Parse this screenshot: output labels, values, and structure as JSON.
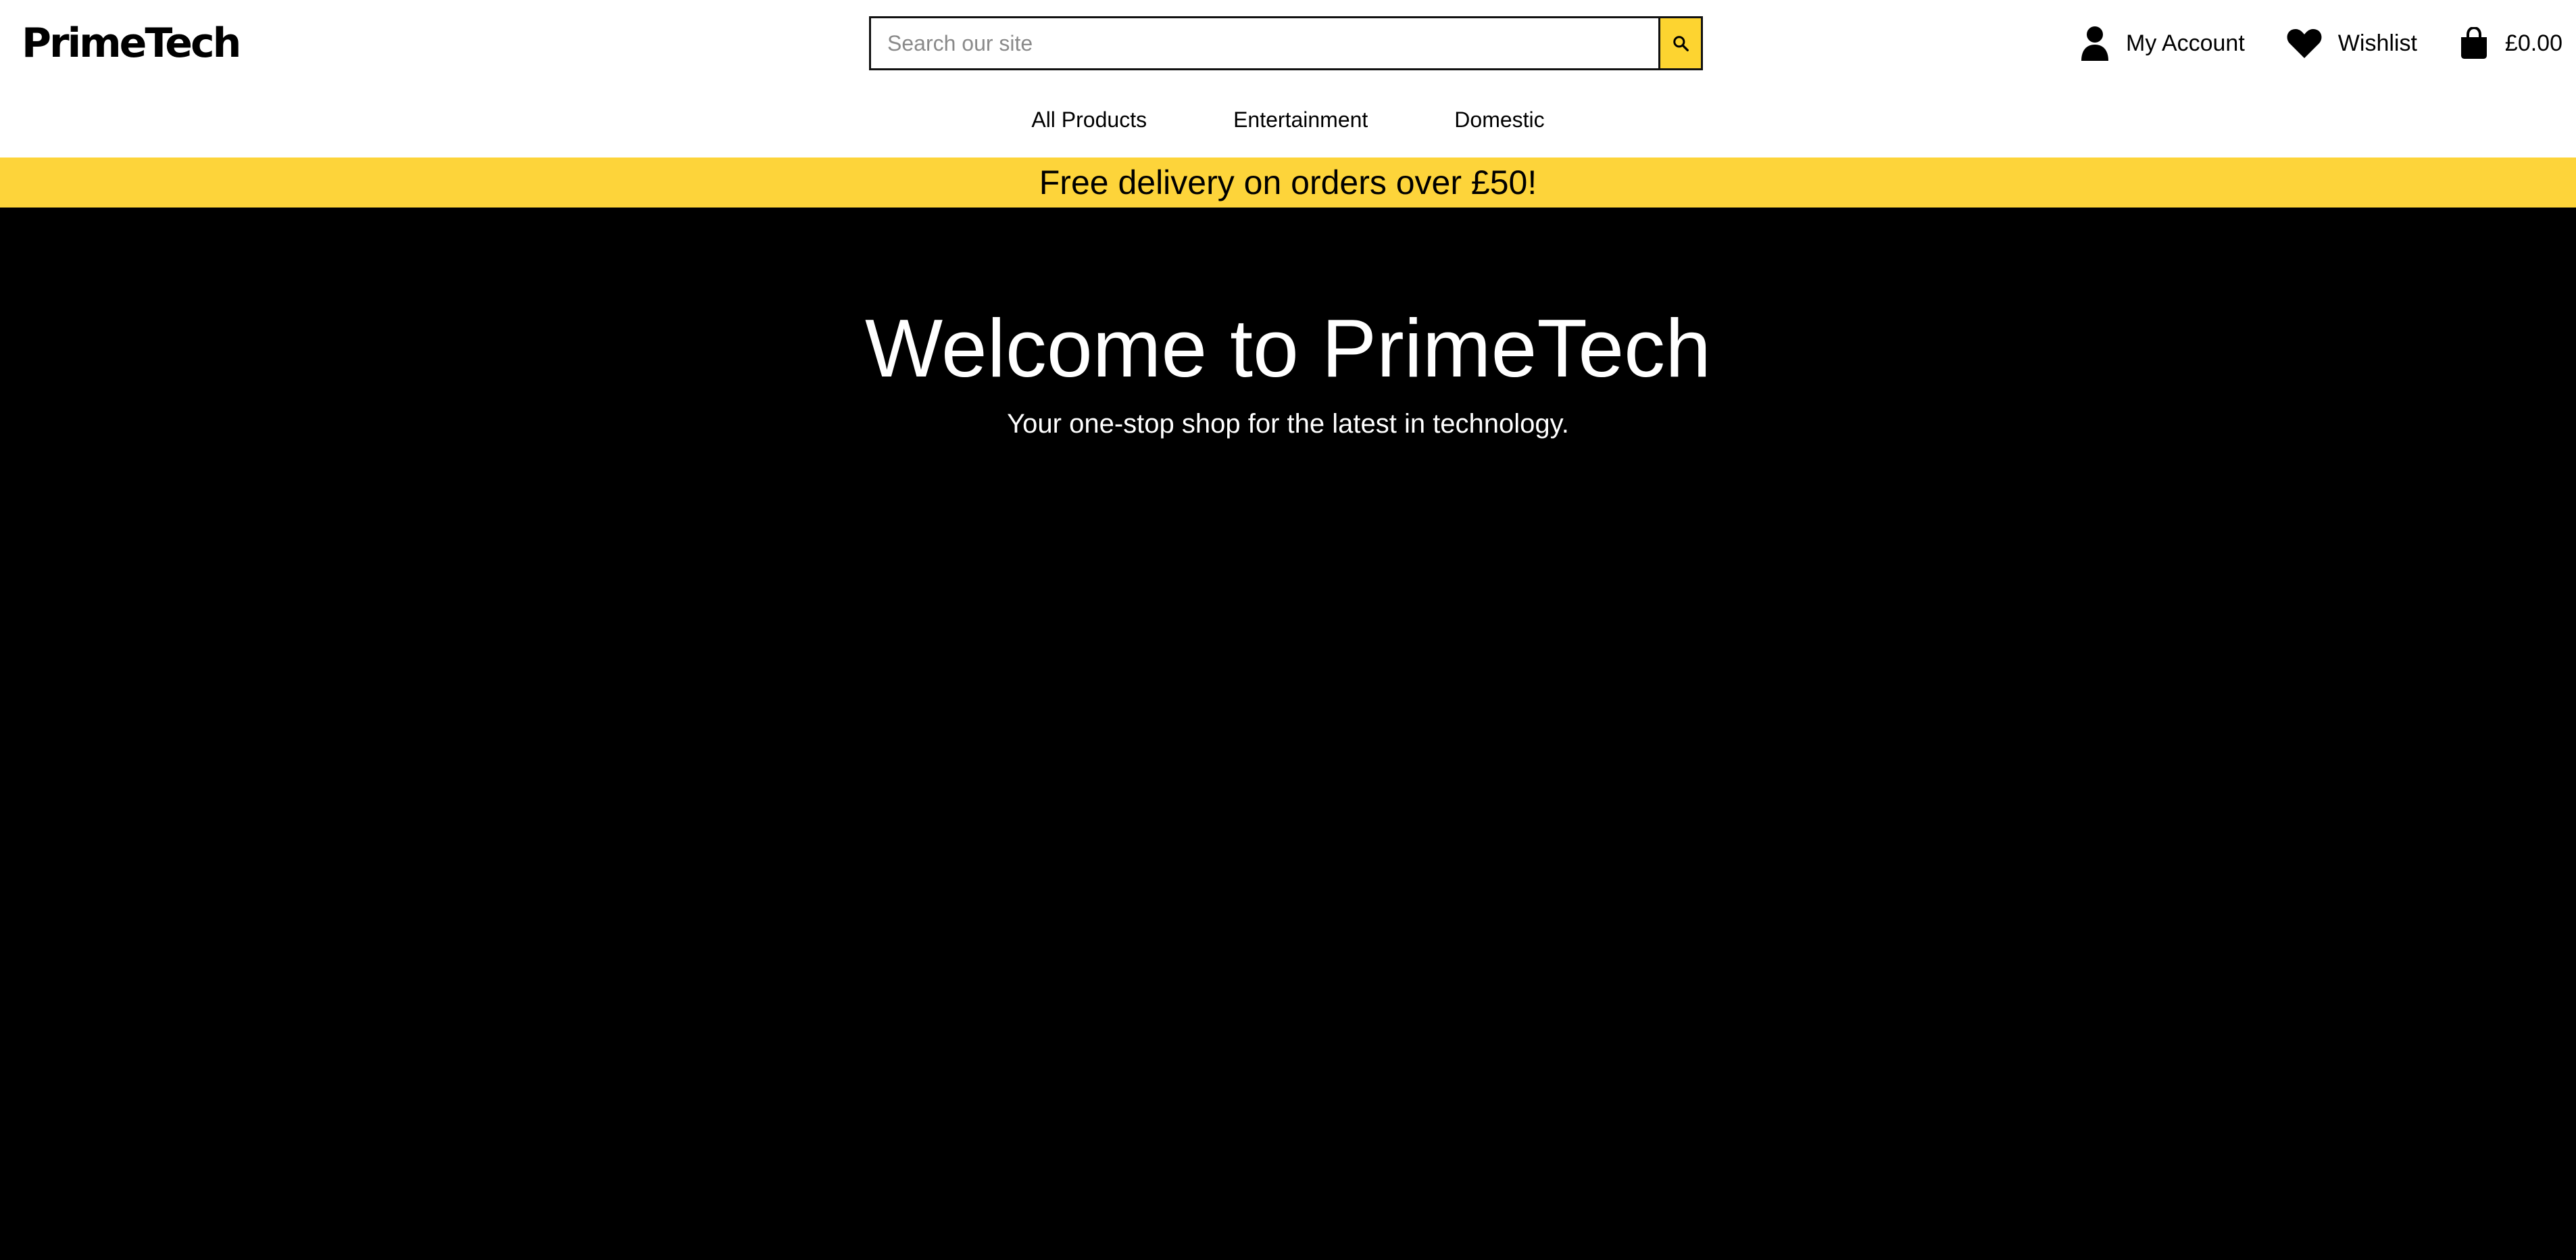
{
  "brand": {
    "logo_text": "PrimeTech"
  },
  "search": {
    "placeholder": "Search our site",
    "value": "",
    "icon": "search-icon"
  },
  "account": {
    "label": "My Account",
    "icon": "user-icon"
  },
  "wishlist": {
    "label": "Wishlist",
    "icon": "heart-icon"
  },
  "basket": {
    "total": "£0.00",
    "icon": "shopping-bag-icon"
  },
  "nav": {
    "items": [
      {
        "label": "All Products"
      },
      {
        "label": "Entertainment"
      },
      {
        "label": "Domestic"
      }
    ]
  },
  "banner": {
    "text": "Free delivery on orders over £50!"
  },
  "hero": {
    "title": "Welcome to PrimeTech",
    "subtitle": "Your one-stop shop for the latest in technology."
  },
  "colors": {
    "accent": "#fdd43a",
    "hero_bg": "#000000",
    "text": "#000000",
    "hero_text": "#ffffff"
  }
}
